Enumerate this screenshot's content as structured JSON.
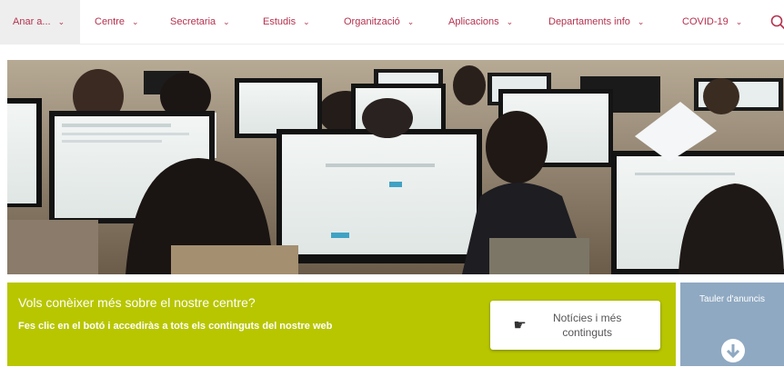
{
  "nav": {
    "items": [
      {
        "label": "Anar a..."
      },
      {
        "label": "Centre"
      },
      {
        "label": "Secretaria"
      },
      {
        "label": "Estudis"
      },
      {
        "label": "Organització"
      },
      {
        "label": "Aplicacions"
      },
      {
        "label": "Departaments info"
      },
      {
        "label": "COVID-19"
      }
    ],
    "search_icon": "search-icon"
  },
  "band": {
    "title": "Vols conèixer més sobre el nostre centre?",
    "text": "Fes clic en el botó i accediràs a tots els continguts del nostre web",
    "button_label": "Notícies i més continguts",
    "button_icon": "pointing-hand-icon"
  },
  "tauler": {
    "label": "Tauler d'anuncis",
    "icon": "arrow-down-circle-icon"
  },
  "colors": {
    "accent": "#b5324f",
    "band": "#b8c600",
    "tauler": "#8fa9c2"
  }
}
